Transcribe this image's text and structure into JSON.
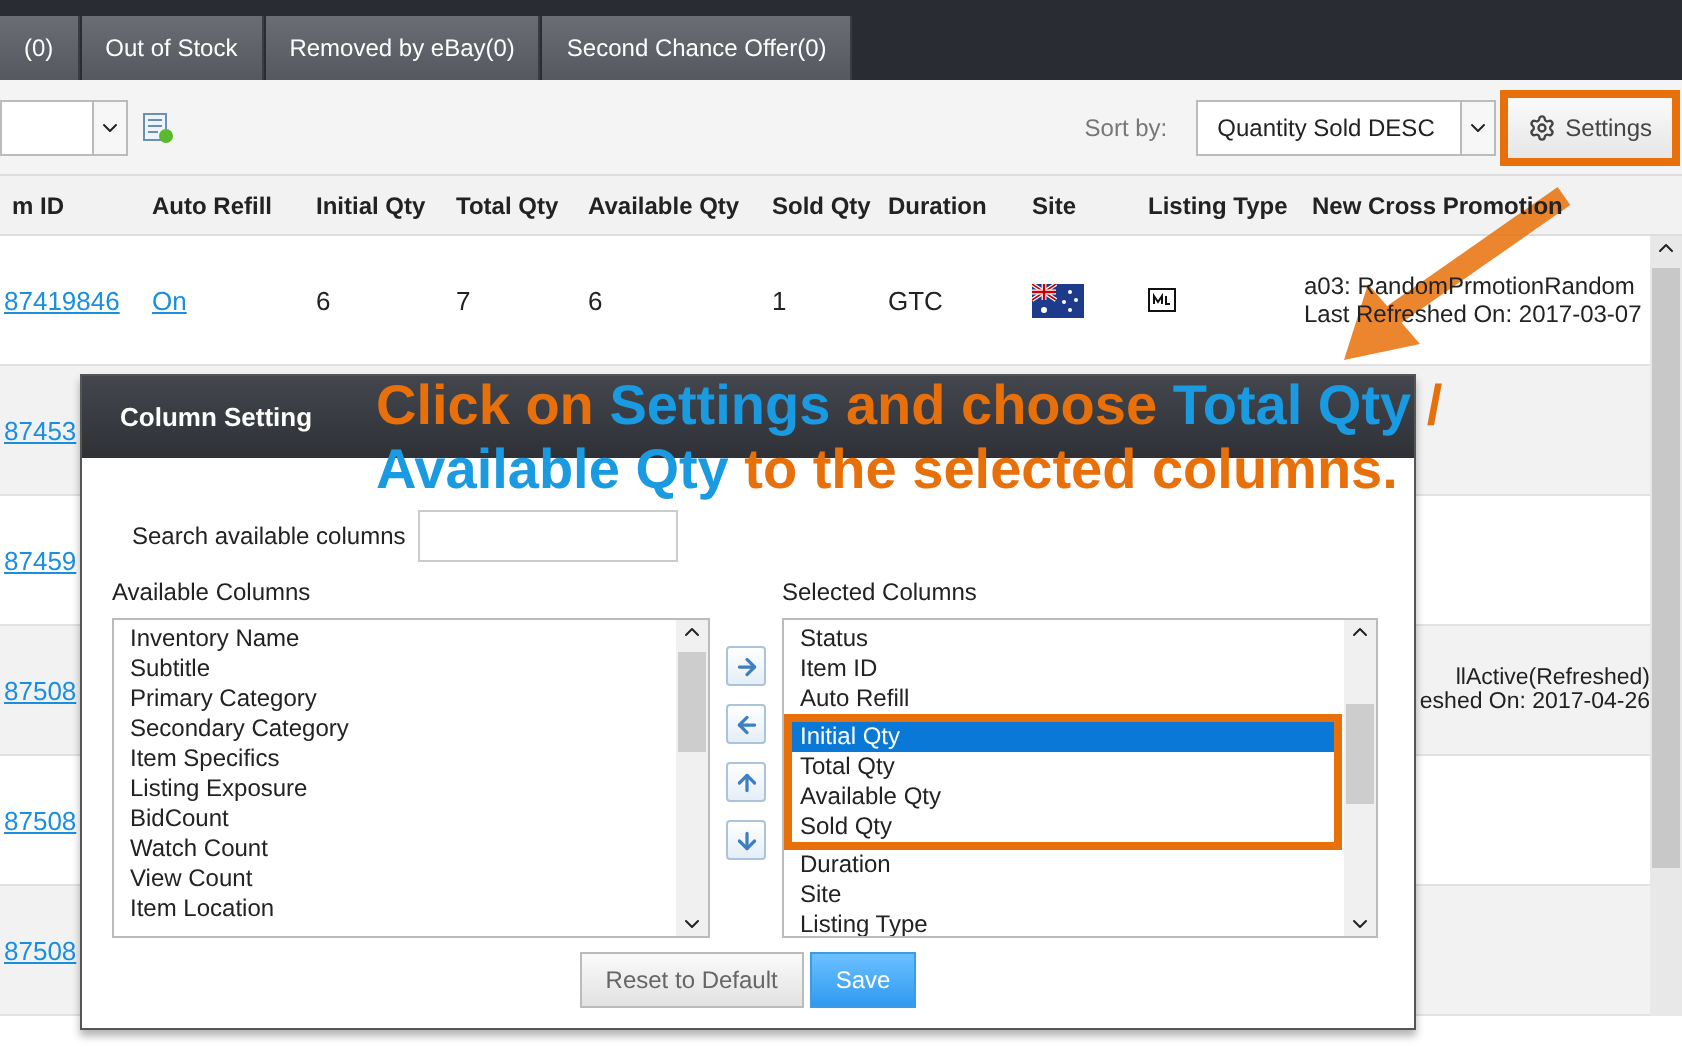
{
  "tabs": [
    {
      "label": "(0)"
    },
    {
      "label": "Out of Stock"
    },
    {
      "label": "Removed by eBay(0)"
    },
    {
      "label": "Second Chance Offer(0)"
    }
  ],
  "toolbar": {
    "sort_label": "Sort by:",
    "sort_value": "Quantity Sold DESC",
    "settings_button": "Settings",
    "settings_highlighted": true
  },
  "table": {
    "columns": [
      "m ID",
      "Auto Refill",
      "Initial Qty",
      "Total Qty",
      "Available Qty",
      "Sold Qty",
      "Duration",
      "Site",
      "Listing Type",
      "New Cross Promotion"
    ],
    "rows": [
      {
        "kind": "full",
        "item_id": "87419846",
        "auto_refill": "On",
        "initial_qty": "6",
        "total_qty": "7",
        "available_qty": "6",
        "sold_qty": "1",
        "duration": "GTC",
        "promotion": [
          "a03: RandomPrmotionRandom",
          "Last Refreshed On: 2017-03-07"
        ]
      },
      {
        "kind": "partial",
        "item_id": "87453",
        "promotion": []
      },
      {
        "kind": "partial",
        "item_id": "87459",
        "promotion": []
      },
      {
        "kind": "partial",
        "item_id": "87508",
        "promotion": [
          "llActive(Refreshed)",
          "eshed On: 2017-04-26"
        ]
      },
      {
        "kind": "partial",
        "item_id": "87508",
        "promotion": []
      },
      {
        "kind": "partial",
        "item_id": "87508",
        "promotion": []
      }
    ]
  },
  "column_setting": {
    "title": "Column Setting",
    "search_label": "Search available columns",
    "available_label": "Available Columns",
    "selected_label": "Selected Columns",
    "available_columns": [
      {
        "label": "Inventory Name",
        "selected": false,
        "highlighted": false
      },
      {
        "label": "Subtitle",
        "selected": false,
        "highlighted": false
      },
      {
        "label": "Primary Category",
        "selected": false,
        "highlighted": false
      },
      {
        "label": "Secondary Category",
        "selected": false,
        "highlighted": false
      },
      {
        "label": "Item Specifics",
        "selected": false,
        "highlighted": false
      },
      {
        "label": "Listing Exposure",
        "selected": false,
        "highlighted": false
      },
      {
        "label": "BidCount",
        "selected": false,
        "highlighted": false
      },
      {
        "label": "Watch Count",
        "selected": false,
        "highlighted": false
      },
      {
        "label": "View Count",
        "selected": false,
        "highlighted": false
      },
      {
        "label": "Item Location",
        "selected": false,
        "highlighted": false
      }
    ],
    "selected_columns": [
      {
        "label": "Status",
        "selected": false,
        "highlighted": false
      },
      {
        "label": "Item ID",
        "selected": false,
        "highlighted": false
      },
      {
        "label": "Auto Refill",
        "selected": false,
        "highlighted": false
      },
      {
        "label": "Initial Qty",
        "selected": true,
        "highlighted": true
      },
      {
        "label": "Total Qty",
        "selected": false,
        "highlighted": true
      },
      {
        "label": "Available Qty",
        "selected": false,
        "highlighted": true
      },
      {
        "label": "Sold Qty",
        "selected": false,
        "highlighted": true
      },
      {
        "label": "Duration",
        "selected": false,
        "highlighted": false
      },
      {
        "label": "Site",
        "selected": false,
        "highlighted": false
      },
      {
        "label": "Listing Type",
        "selected": false,
        "highlighted": false
      }
    ],
    "buttons": [
      "Reset to Default",
      "Save"
    ]
  },
  "annotation": {
    "lines": [
      [
        {
          "text": "Click on ",
          "kind": "plain"
        },
        {
          "text": "Settings",
          "kind": "emphasis"
        },
        {
          "text": " and choose ",
          "kind": "plain"
        },
        {
          "text": "Total Qty",
          "kind": "emphasis"
        },
        {
          "text": " /",
          "kind": "plain"
        }
      ],
      [
        {
          "text": "Available Qty",
          "kind": "emphasis"
        },
        {
          "text": " to the selected columns.",
          "kind": "plain"
        }
      ]
    ]
  }
}
